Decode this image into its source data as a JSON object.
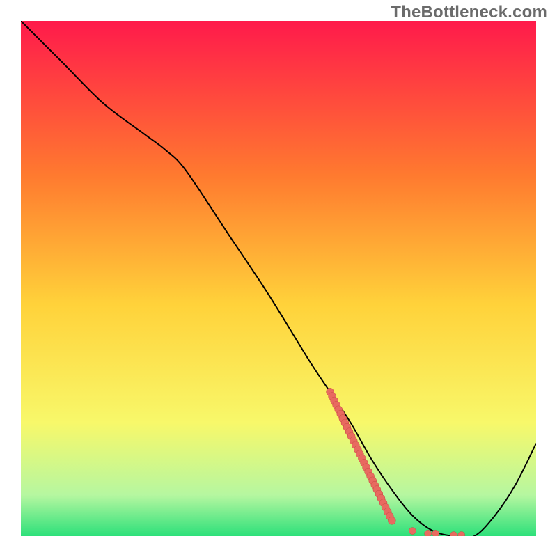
{
  "watermark": "TheBottleneck.com",
  "colors": {
    "gradient_top": "#ff1a4b",
    "gradient_mid_upper": "#ff7a2f",
    "gradient_mid": "#ffd23a",
    "gradient_mid_lower": "#f8f86a",
    "gradient_green_light": "#b6f7a0",
    "gradient_green": "#2de07a",
    "line": "#000000",
    "dot_fill": "#e86a60",
    "dot_stroke": "#c74a42"
  },
  "chart_data": {
    "type": "line",
    "title": "",
    "xlabel": "",
    "ylabel": "",
    "xlim": [
      0,
      100
    ],
    "ylim": [
      0,
      100
    ],
    "series": [
      {
        "name": "curve",
        "x": [
          0,
          8,
          16,
          24,
          28,
          32,
          40,
          48,
          56,
          60,
          64,
          68,
          72,
          76,
          80,
          84,
          88,
          92,
          96,
          100
        ],
        "y": [
          100,
          92,
          84,
          78,
          75,
          71,
          59,
          47,
          34,
          28,
          22,
          15,
          9,
          4,
          1,
          0,
          0,
          4,
          10,
          18
        ]
      }
    ],
    "dots": {
      "segment": {
        "x0": 60,
        "y0": 28,
        "x1": 72,
        "y1": 3,
        "count": 30
      },
      "scatter_bottom": [
        {
          "x": 76,
          "y": 1
        },
        {
          "x": 79,
          "y": 0.5
        },
        {
          "x": 80.5,
          "y": 0.5
        },
        {
          "x": 84,
          "y": 0.2
        },
        {
          "x": 85.5,
          "y": 0.2
        }
      ]
    }
  }
}
